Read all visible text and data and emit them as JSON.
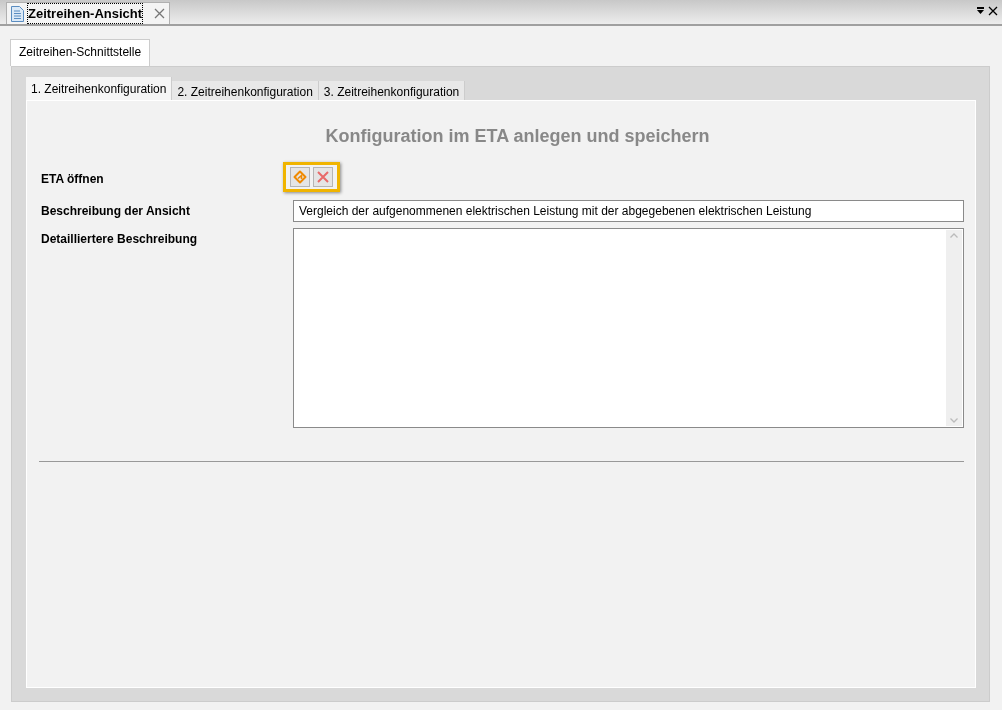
{
  "document_tab": {
    "title": "Zeitreihen-Ansicht",
    "selected": true
  },
  "outer_tabs": [
    {
      "label": "Zeitreihen-Schnittstelle",
      "selected": true
    }
  ],
  "inner_tabs": [
    {
      "label": "1. Zeitreihenkonfiguration",
      "selected": true
    },
    {
      "label": "2. Zeitreihenkonfiguration",
      "selected": false
    },
    {
      "label": "3. Zeitreihenkonfiguration",
      "selected": false
    }
  ],
  "heading": "Konfiguration im ETA anlegen und speichern",
  "fields": [
    {
      "kind": "buttons",
      "label": "ETA öffnen",
      "highlighted": true
    },
    {
      "kind": "text",
      "label": "Beschreibung der Ansicht",
      "value": "Vergleich der aufgenommenen elektrischen Leistung mit der abgegebenen elektrischen Leistung"
    },
    {
      "kind": "textarea",
      "label": "Detailliertere Beschreibung"
    }
  ]
}
